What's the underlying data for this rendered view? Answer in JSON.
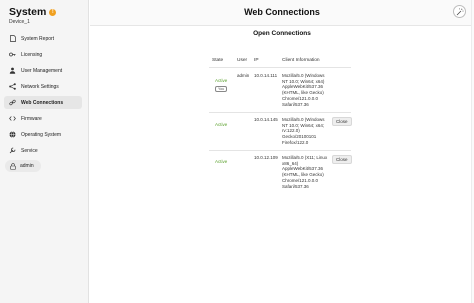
{
  "app": {
    "title": "System",
    "warning_badge": "!",
    "device": "Device_1"
  },
  "sidebar": {
    "items": [
      {
        "label": "System Report",
        "icon": "file-icon"
      },
      {
        "label": "Licensing",
        "icon": "key-icon"
      },
      {
        "label": "User Management",
        "icon": "user-icon"
      },
      {
        "label": "Network Settings",
        "icon": "network-icon"
      },
      {
        "label": "Web Connections",
        "icon": "link-icon",
        "active": true
      },
      {
        "label": "Firmware",
        "icon": "code-icon"
      },
      {
        "label": "Operating System",
        "icon": "globe-icon"
      },
      {
        "label": "Service",
        "icon": "wrench-icon"
      }
    ],
    "user": "admin"
  },
  "header": {
    "title": "Web Connections"
  },
  "main": {
    "section_title": "Open Connections",
    "columns": [
      "State",
      "User",
      "IP",
      "Client Information"
    ],
    "rows": [
      {
        "state": "Active",
        "you_badge": "You",
        "user": "admin",
        "ip": "10.0.14.111",
        "client": [
          "Mozilla/5.0 (Windows",
          "NT 10.0; Win64; x64)",
          "AppleWebKit/537.36",
          "(KHTML, like Gecko)",
          "Chrome/121.0.0.0",
          "Safari/537.36"
        ],
        "close": ""
      },
      {
        "state": "Active",
        "you_badge": "",
        "user": "",
        "ip": "10.0.14.145",
        "client": [
          "Mozilla/5.0 (Windows",
          "NT 10.0; Win64; x64;",
          "rv:122.0)",
          "Gecko/20100101",
          "Firefox/122.0"
        ],
        "close": "Close"
      },
      {
        "state": "Active",
        "you_badge": "",
        "user": "",
        "ip": "10.0.12.109",
        "client": [
          "Mozilla/5.0 (X11; Linux",
          "x86_64)",
          "AppleWebKit/537.36",
          "(KHTML, like Gecko)",
          "Chrome/121.0.0.0",
          "Safari/537.36"
        ],
        "close": "Close"
      }
    ]
  },
  "colors": {
    "active": "#5aa02c",
    "warning": "#f0a020",
    "sidebar_bg": "#f5f5f5"
  }
}
